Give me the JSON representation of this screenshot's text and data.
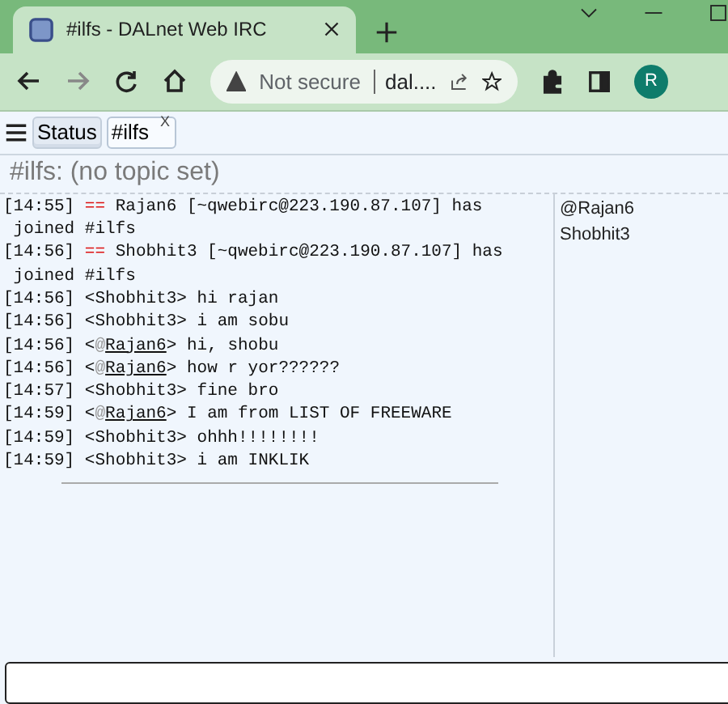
{
  "browser": {
    "tab_title": "#ilfs - DALnet Web IRC",
    "security": "Not secure",
    "address": "dal....",
    "profile_initial": "R"
  },
  "irc_tabs": [
    {
      "label": "Status",
      "selected": false
    },
    {
      "label": "#ilfs",
      "selected": true,
      "close_mark": "X"
    }
  ],
  "topic": "#ilfs: (no topic set)",
  "lines": [
    {
      "time": "[14:55]",
      "kind": "join",
      "marker": "==",
      "text": "Rajan6 [~qwebirc@223.190.87.107] has joined #ilfs"
    },
    {
      "time": "[14:56]",
      "kind": "join",
      "marker": "==",
      "text": "Shobhit3 [~qwebirc@223.190.87.107] has joined #ilfs"
    },
    {
      "time": "[14:56]",
      "kind": "message",
      "open": "<",
      "nick": "Shobhit3",
      "close": ">",
      "text": "hi rajan"
    },
    {
      "time": "[14:56]",
      "kind": "message",
      "open": "<",
      "nick": "Shobhit3",
      "close": ">",
      "text": "i am sobu"
    },
    {
      "time": "[14:56]",
      "kind": "message",
      "open": "<",
      "op_mark": "@",
      "nick": "Rajan6",
      "close": ">",
      "text": "hi, shobu"
    },
    {
      "time": "[14:56]",
      "kind": "message",
      "open": "<",
      "op_mark": "@",
      "nick": "Rajan6",
      "close": ">",
      "text": "how r yor??????"
    },
    {
      "time": "[14:57]",
      "kind": "message",
      "open": "<",
      "nick": "Shobhit3",
      "close": ">",
      "text": "fine bro"
    },
    {
      "time": "[14:59]",
      "kind": "message",
      "open": "<",
      "op_mark": "@",
      "nick": "Rajan6",
      "close": ">",
      "text": "I am from LIST OF FREEWARE"
    },
    {
      "time": "[14:59]",
      "kind": "message",
      "open": "<",
      "nick": "Shobhit3",
      "close": ">",
      "text": "ohhh!!!!!!!!"
    },
    {
      "time": "[14:59]",
      "kind": "message",
      "open": "<",
      "nick": "Shobhit3",
      "close": ">",
      "text": "i am INKLIK"
    }
  ],
  "nicklist": [
    "@Rajan6",
    "Shobhit3"
  ]
}
